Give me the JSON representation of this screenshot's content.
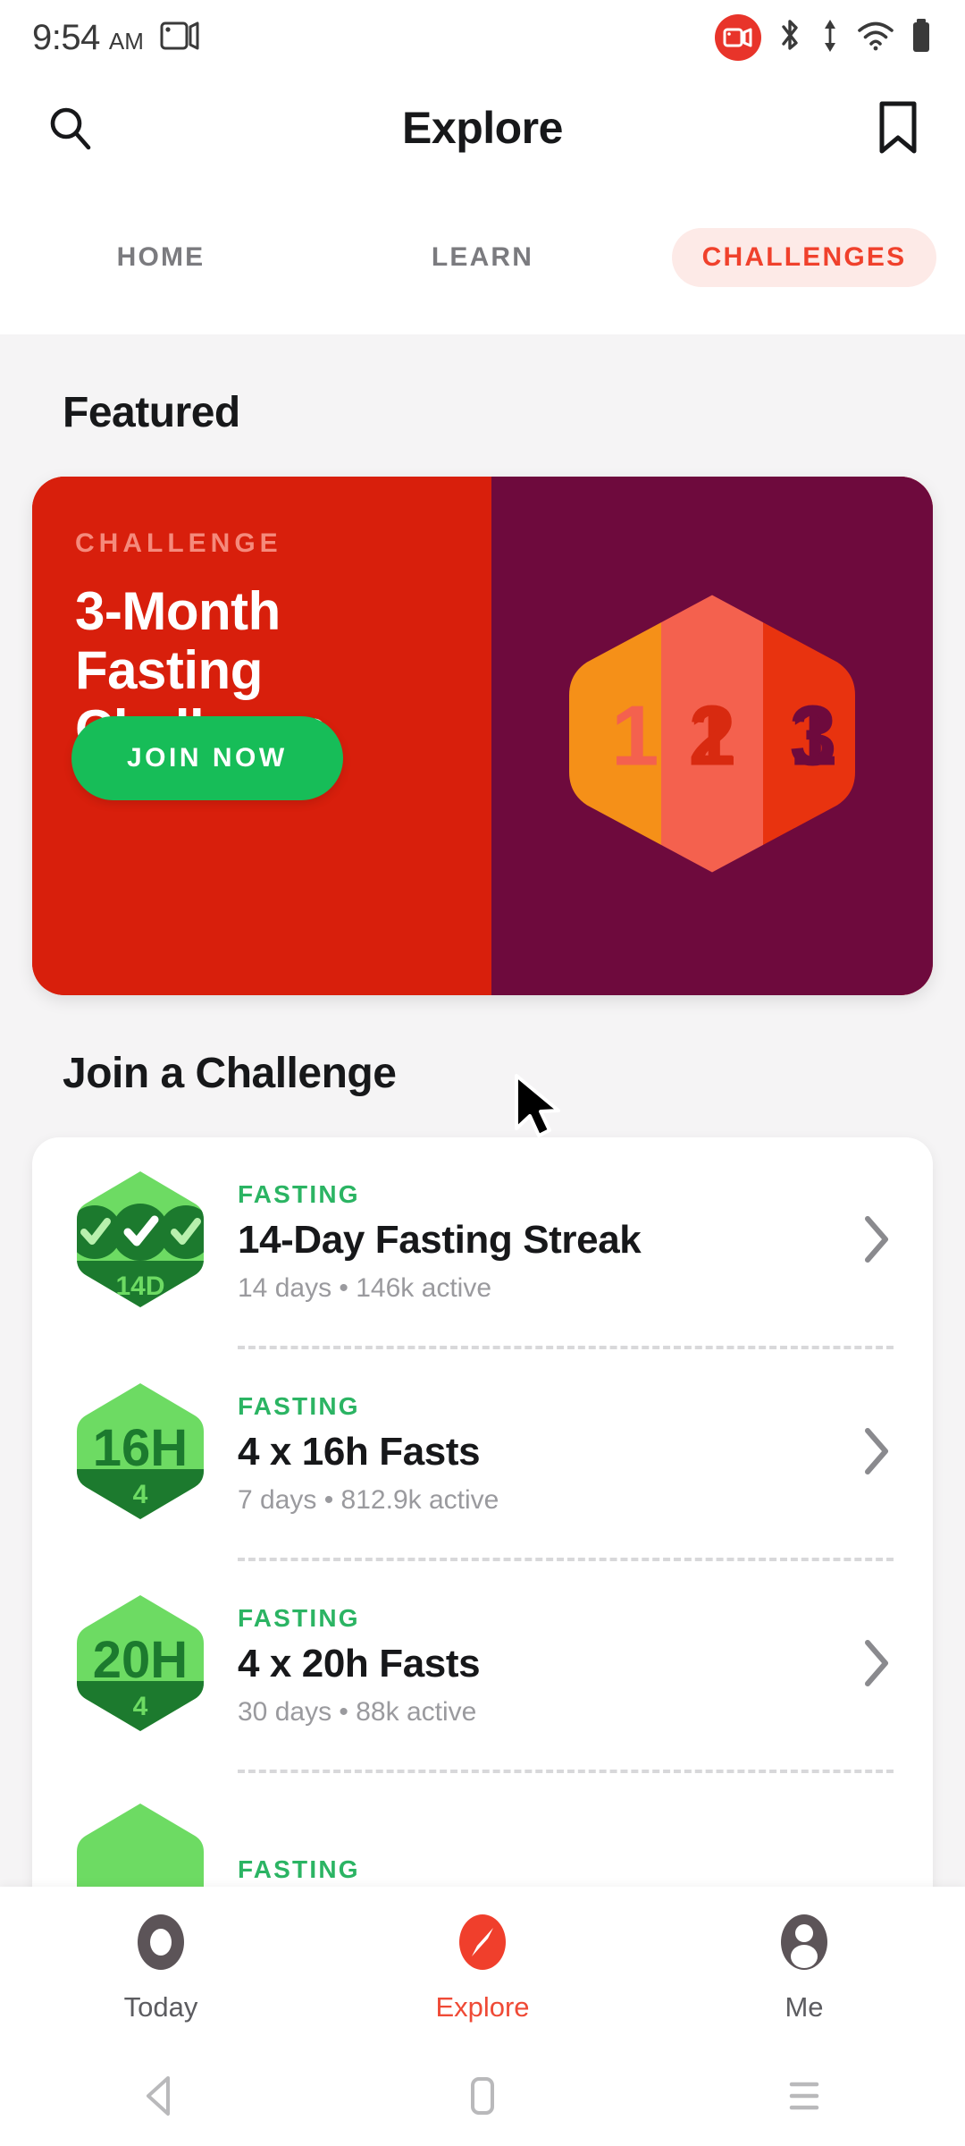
{
  "status_bar": {
    "time": "9:54",
    "ampm": "AM",
    "screencast_icon": "screen-record-icon",
    "recording_icon": "recording-badge-icon",
    "bluetooth_icon": "bluetooth-icon",
    "data_transfer_icon": "data-transfer-icon",
    "wifi_icon": "wifi-icon",
    "battery_icon": "battery-icon"
  },
  "app_bar": {
    "title": "Explore",
    "search_icon": "search-icon",
    "bookmark_icon": "bookmark-icon"
  },
  "tabs": [
    {
      "label": "HOME",
      "active": false
    },
    {
      "label": "LEARN",
      "active": false
    },
    {
      "label": "CHALLENGES",
      "active": true
    }
  ],
  "featured": {
    "heading": "Featured",
    "kicker": "CHALLENGE",
    "title_lines": [
      "3-Month",
      "Fasting",
      "Challenge"
    ],
    "title": "3-Month Fasting Challenge",
    "cta_label": "JOIN NOW",
    "artwork": {
      "name": "numbered-hexagon-icon",
      "numbers": [
        "1",
        "2",
        "3"
      ],
      "band_colors": [
        "#f59018",
        "#f4614e",
        "#e8330f"
      ],
      "number_colors": [
        "#f4614e",
        "#d82a10",
        "#6e0a3d"
      ]
    },
    "colors": {
      "card_left": "#d81f0c",
      "card_right": "#6e0a3d",
      "cta": "#17bd58",
      "kicker": "#f58a7c"
    }
  },
  "join_section": {
    "heading": "Join a Challenge",
    "items": [
      {
        "category": "FASTING",
        "title": "14-Day Fasting Streak",
        "meta": "14 days • 146k active",
        "badge_text": "",
        "badge_sub": "14D",
        "badge_type": "checkmarks",
        "chevron": "chevron-right-icon"
      },
      {
        "category": "FASTING",
        "title": "4 x 16h Fasts",
        "meta": "7 days • 812.9k active",
        "badge_text": "16H",
        "badge_sub": "4",
        "badge_type": "text",
        "chevron": "chevron-right-icon"
      },
      {
        "category": "FASTING",
        "title": "4 x 20h Fasts",
        "meta": "30 days • 88k active",
        "badge_text": "20H",
        "badge_sub": "4",
        "badge_type": "text",
        "chevron": "chevron-right-icon"
      },
      {
        "category": "FASTING",
        "title": "",
        "meta": "",
        "badge_text": "",
        "badge_sub": "",
        "badge_type": "partial",
        "chevron": "chevron-right-icon"
      }
    ],
    "colors": {
      "category": "#2bb463",
      "badge_light": "#6ddb63",
      "badge_dark": "#1c7a2e"
    }
  },
  "bottom_nav": [
    {
      "label": "Today",
      "icon": "today-ring-icon",
      "active": false
    },
    {
      "label": "Explore",
      "icon": "compass-icon",
      "active": true
    },
    {
      "label": "Me",
      "icon": "person-icon",
      "active": false
    }
  ],
  "android_nav": [
    {
      "icon": "back-triangle-icon"
    },
    {
      "icon": "home-square-icon"
    },
    {
      "icon": "recents-lines-icon"
    }
  ],
  "cursor": {
    "icon": "mouse-pointer-icon"
  }
}
